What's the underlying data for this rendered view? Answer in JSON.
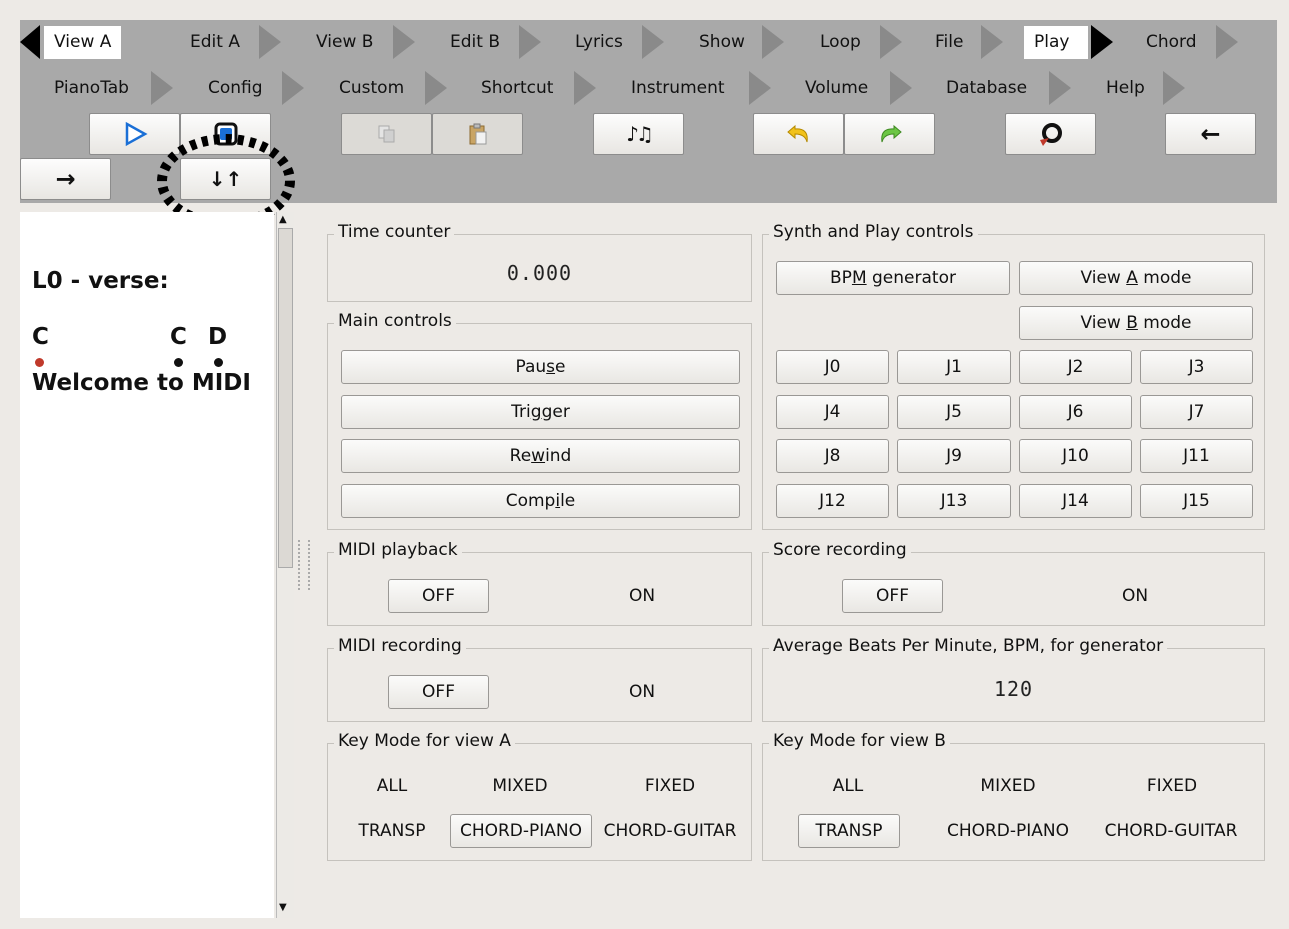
{
  "tabs_row1": [
    {
      "label": "View A",
      "active": true
    },
    {
      "label": "Edit A"
    },
    {
      "label": "View B"
    },
    {
      "label": "Edit B"
    },
    {
      "label": "Lyrics"
    },
    {
      "label": "Show"
    },
    {
      "label": "Loop"
    },
    {
      "label": "File"
    },
    {
      "label": "Play",
      "active": true
    },
    {
      "label": "Chord"
    }
  ],
  "tabs_row2": [
    {
      "label": "PianoTab"
    },
    {
      "label": "Config"
    },
    {
      "label": "Custom"
    },
    {
      "label": "Shortcut"
    },
    {
      "label": "Instrument"
    },
    {
      "label": "Volume"
    },
    {
      "label": "Database"
    },
    {
      "label": "Help"
    }
  ],
  "toolbar_icons": [
    "play-icon",
    "stop-icon",
    "copy-icon",
    "paste-icon",
    "notes-icon",
    "undo-icon",
    "redo-icon",
    "loop-icon",
    "arrow-left-icon",
    "arrow-right-icon",
    "swap-icon"
  ],
  "lyrics": {
    "section": "L0 - verse:",
    "chords": [
      "C",
      "C",
      "D"
    ],
    "line": "Welcome to MIDI"
  },
  "time_counter": {
    "title": "Time counter",
    "value": "0.000"
  },
  "main_controls": {
    "title": "Main controls",
    "buttons": [
      {
        "pre": "Pau",
        "u": "s",
        "post": "e"
      },
      {
        "pre": "Tri",
        "u": "g",
        "post": "ger"
      },
      {
        "pre": "Re",
        "u": "w",
        "post": "ind"
      },
      {
        "pre": "Comp",
        "u": "i",
        "post": "le"
      }
    ]
  },
  "synth": {
    "title": "Synth and Play controls",
    "bpm_gen": {
      "pre": "BP",
      "u": "M",
      "post": " generator"
    },
    "view_a": {
      "pre": "View ",
      "u": "A",
      "post": " mode"
    },
    "view_b": {
      "pre": "View ",
      "u": "B",
      "post": " mode"
    },
    "jumps": [
      "J0",
      "J1",
      "J2",
      "J3",
      "J4",
      "J5",
      "J6",
      "J7",
      "J8",
      "J9",
      "J10",
      "J11",
      "J12",
      "J13",
      "J14",
      "J15"
    ]
  },
  "midi_playback": {
    "title": "MIDI playback",
    "off": "OFF",
    "on": "ON"
  },
  "score_recording": {
    "title": "Score recording",
    "off": "OFF",
    "on": "ON"
  },
  "midi_recording": {
    "title": "MIDI recording",
    "off": "OFF",
    "on": "ON"
  },
  "bpm": {
    "title": "Average Beats Per Minute, BPM, for generator",
    "value": "120"
  },
  "key_mode_a": {
    "title": "Key Mode for view A",
    "options": [
      "ALL",
      "MIXED",
      "FIXED",
      "TRANSP",
      "CHORD-PIANO",
      "CHORD-GUITAR"
    ],
    "selected": "CHORD-PIANO"
  },
  "key_mode_b": {
    "title": "Key Mode for view B",
    "options": [
      "ALL",
      "MIXED",
      "FIXED",
      "TRANSP",
      "CHORD-PIANO",
      "CHORD-GUITAR"
    ],
    "selected": "TRANSP"
  },
  "colors": {
    "toolbar": "#a9a9a9",
    "play_accent": "#1a6fd6",
    "active_dot": "#c0392b",
    "undo": "#e6a800",
    "redo": "#4caf30"
  }
}
